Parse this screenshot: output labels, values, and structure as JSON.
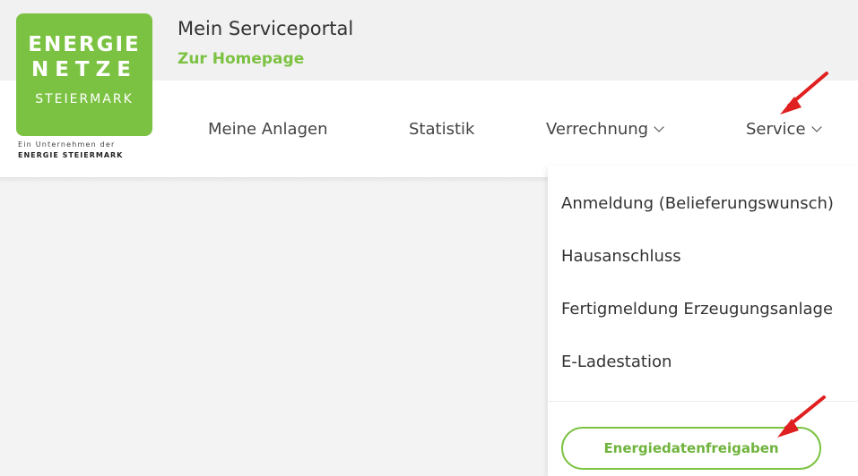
{
  "brand": {
    "logo_line1": "ENERGIE",
    "logo_line2": "NETZE",
    "logo_line3": "STEIERMARK",
    "logo_sub1": "Ein Unternehmen der",
    "logo_sub2": "ENERGIE STEIERMARK",
    "green": "#7cc242"
  },
  "header": {
    "title": "Mein Serviceportal",
    "homepage_link": "Zur Homepage"
  },
  "nav": {
    "items": [
      {
        "label": "Meine Anlagen",
        "has_dropdown": false
      },
      {
        "label": "Statistik",
        "has_dropdown": false
      },
      {
        "label": "Verrechnung",
        "has_dropdown": true
      },
      {
        "label": "Service",
        "has_dropdown": true
      }
    ]
  },
  "service_menu": {
    "items": [
      "Anmeldung (Belieferungswunsch)",
      "Hausanschluss",
      "Fertigmeldung Erzeugungsanlage",
      "E-Ladestation"
    ],
    "button_label": "Energiedatenfreigaben"
  },
  "annotations": {
    "arrow_color": "#e02020"
  }
}
